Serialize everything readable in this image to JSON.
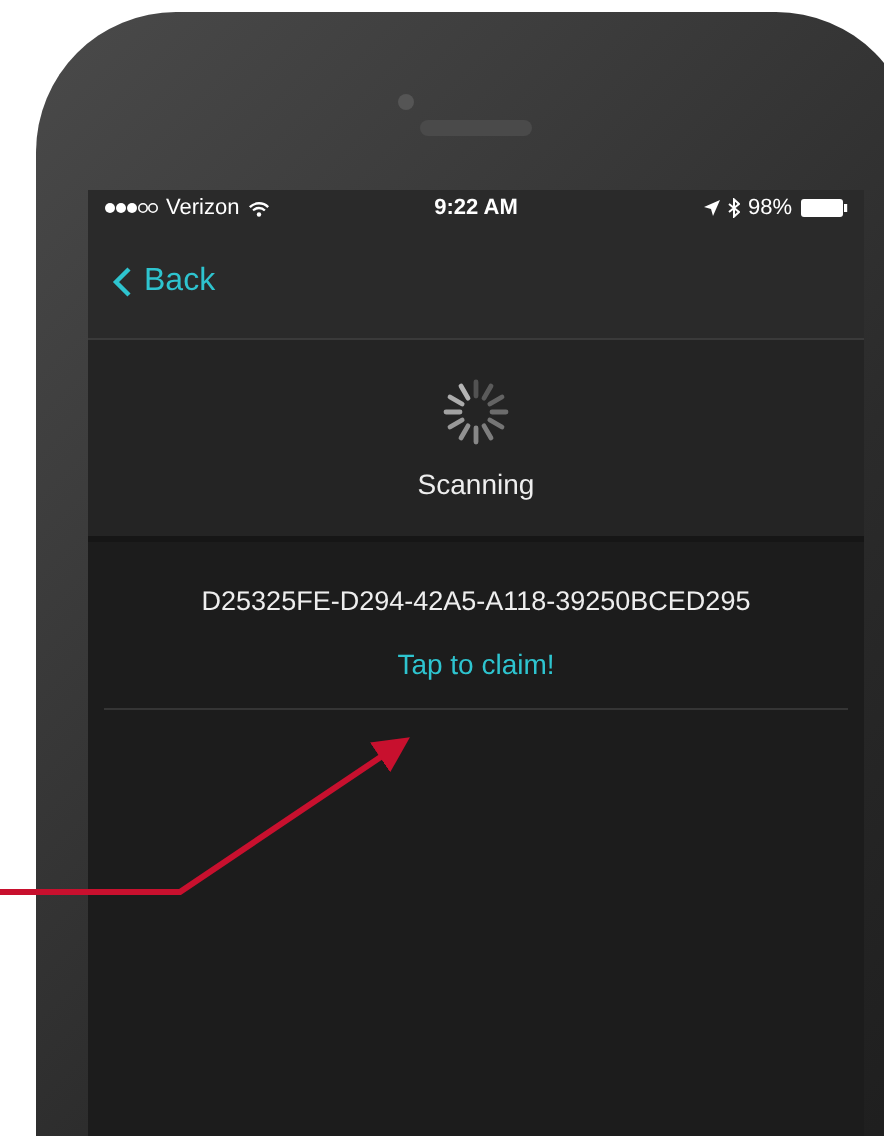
{
  "status_bar": {
    "carrier": "Verizon",
    "time": "9:22 AM",
    "battery": "98%"
  },
  "nav": {
    "back": "Back"
  },
  "scanner": {
    "status": "Scanning"
  },
  "devices": [
    {
      "uuid": "D25325FE-D294-42A5-A118-39250BCED295",
      "action": "Tap to claim!"
    }
  ]
}
